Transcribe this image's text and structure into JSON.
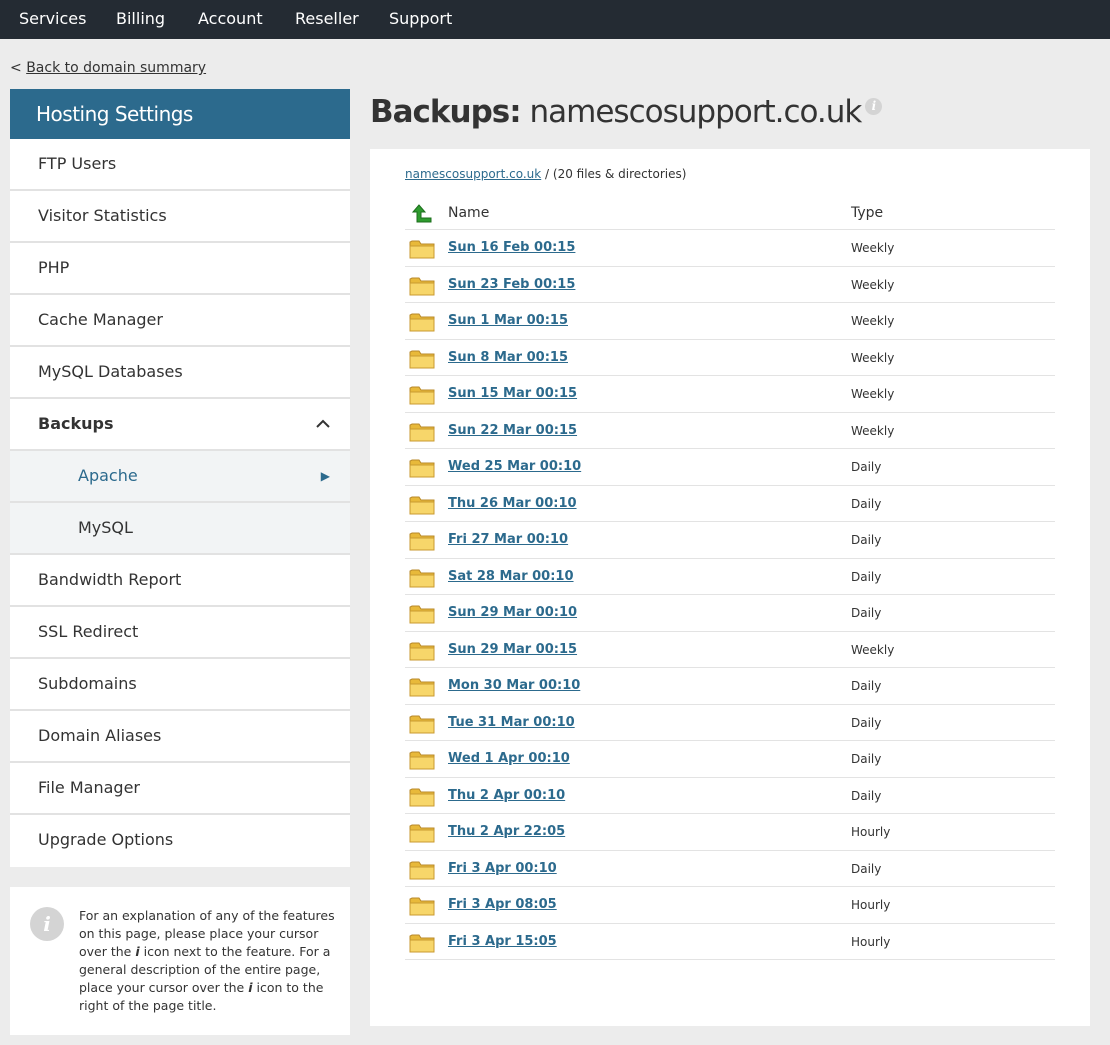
{
  "topnav": {
    "items": [
      "Services",
      "Billing",
      "Account",
      "Reseller",
      "Support"
    ]
  },
  "back": {
    "prefix": "<",
    "label": "Back to domain summary"
  },
  "sidebar": {
    "title": "Hosting Settings",
    "items": [
      "FTP Users",
      "Visitor Statistics",
      "PHP",
      "Cache Manager",
      "MySQL Databases",
      "Backups",
      "Bandwidth Report",
      "SSL Redirect",
      "Subdomains",
      "Domain Aliases",
      "File Manager",
      "Upgrade Options"
    ],
    "backups_sub": [
      "Apache",
      "MySQL"
    ],
    "active_sub_arrow": "▶"
  },
  "info": {
    "text_before": "For an explanation of any of the features on this page, please place your cursor over the ",
    "i1": "i",
    "text_mid": " icon next to the feature. For a general description of the entire page, place your cursor over the ",
    "i2": "i",
    "text_after": " icon to the right of the page title."
  },
  "title": {
    "prefix": "Backups:",
    "domain": "namescosupport.co.uk",
    "info_glyph": "i"
  },
  "crumb": {
    "link": "namescosupport.co.uk",
    "rest": " / (20 files & directories)"
  },
  "table": {
    "headers": {
      "name": "Name",
      "type": "Type"
    },
    "rows": [
      {
        "name": "Sun 16 Feb 00:15",
        "type": "Weekly"
      },
      {
        "name": "Sun 23 Feb 00:15",
        "type": "Weekly"
      },
      {
        "name": "Sun 1 Mar 00:15",
        "type": "Weekly"
      },
      {
        "name": "Sun 8 Mar 00:15",
        "type": "Weekly"
      },
      {
        "name": "Sun 15 Mar 00:15",
        "type": "Weekly"
      },
      {
        "name": "Sun 22 Mar 00:15",
        "type": "Weekly"
      },
      {
        "name": "Wed 25 Mar 00:10",
        "type": "Daily"
      },
      {
        "name": "Thu 26 Mar 00:10",
        "type": "Daily"
      },
      {
        "name": "Fri 27 Mar 00:10",
        "type": "Daily"
      },
      {
        "name": "Sat 28 Mar 00:10",
        "type": "Daily"
      },
      {
        "name": "Sun 29 Mar 00:10",
        "type": "Daily"
      },
      {
        "name": "Sun 29 Mar 00:15",
        "type": "Weekly"
      },
      {
        "name": "Mon 30 Mar 00:10",
        "type": "Daily"
      },
      {
        "name": "Tue 31 Mar 00:10",
        "type": "Daily"
      },
      {
        "name": "Wed 1 Apr 00:10",
        "type": "Daily"
      },
      {
        "name": "Thu 2 Apr 00:10",
        "type": "Daily"
      },
      {
        "name": "Thu 2 Apr 22:05",
        "type": "Hourly"
      },
      {
        "name": "Fri 3 Apr 00:10",
        "type": "Daily"
      },
      {
        "name": "Fri 3 Apr 08:05",
        "type": "Hourly"
      },
      {
        "name": "Fri 3 Apr 15:05",
        "type": "Hourly"
      }
    ]
  }
}
